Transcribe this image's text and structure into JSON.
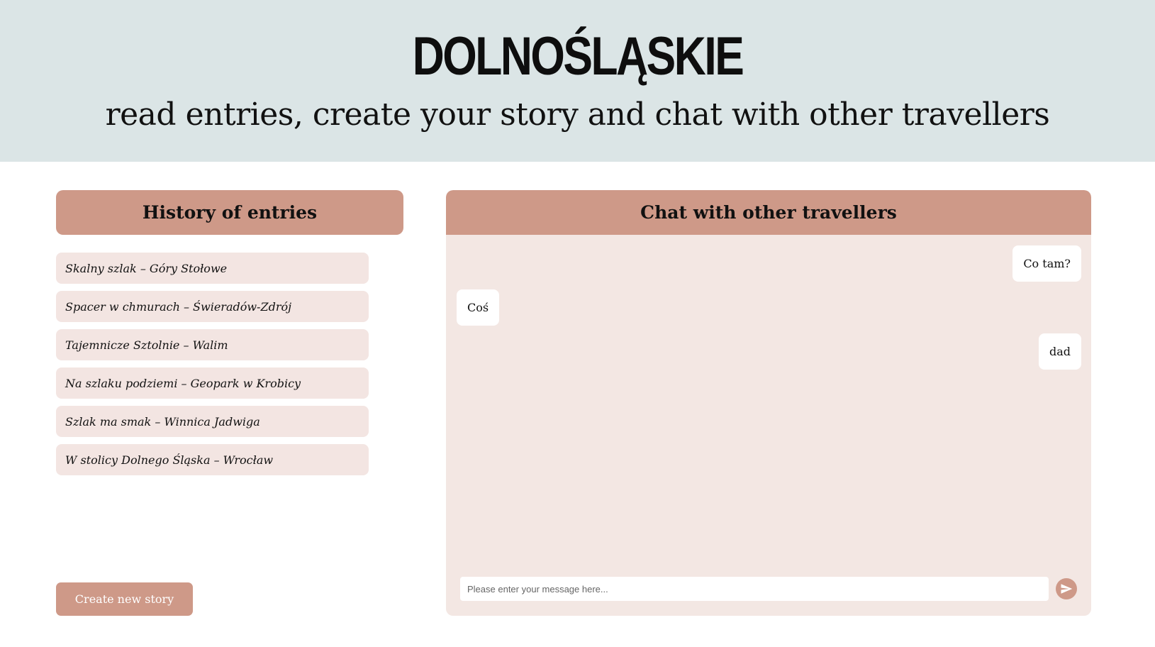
{
  "header": {
    "title": "DOLNOŚLĄSKIE",
    "subtitle": "read entries, create your story and chat with other travellers"
  },
  "history": {
    "title": "History of entries",
    "entries": [
      "Skalny szlak – Góry Stołowe",
      "Spacer w chmurach – Świeradów-Zdrój",
      "Tajemnicze Sztolnie – Walim",
      "Na szlaku podziemi – Geopark w Krobicy",
      "Szlak ma smak – Winnica Jadwiga",
      "W stolicy Dolnego Śląska – Wrocław"
    ],
    "create_label": "Create new story"
  },
  "chat": {
    "title": "Chat with other travellers",
    "messages": [
      {
        "text": "Co tam?",
        "side": "right"
      },
      {
        "text": "Coś",
        "side": "left"
      },
      {
        "text": "dad",
        "side": "right"
      }
    ],
    "input_placeholder": "Please enter your message here...",
    "input_value": "",
    "send_icon": "send-icon"
  },
  "colors": {
    "header_bg": "#dbe5e6",
    "accent": "#ce9988",
    "entry_bg": "#f3e5e2",
    "chat_bg": "#f3e7e3"
  }
}
